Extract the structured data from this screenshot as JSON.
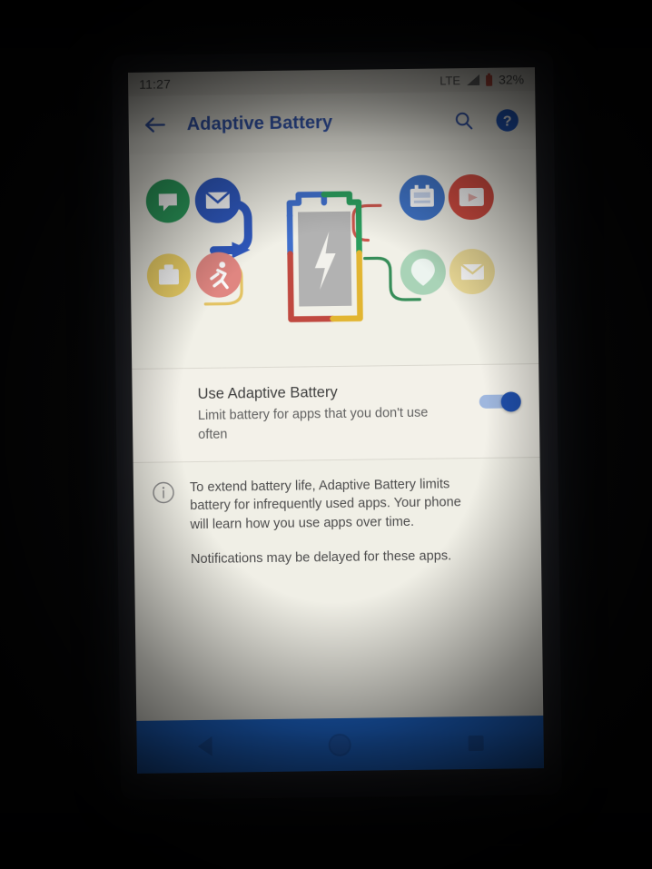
{
  "statusbar": {
    "clock": "11:27",
    "network": "LTE",
    "battery_percent": "32%",
    "signal_icon": "signal-bars-icon",
    "battery_icon": "battery-low-icon"
  },
  "appbar": {
    "title": "Adaptive Battery",
    "back_icon": "arrow-back-icon",
    "search_icon": "search-icon",
    "help_icon": "help-circle-icon",
    "title_color": "#2f55b3"
  },
  "illustration": {
    "name": "adaptive-battery-illustration",
    "battery_glyph": "lightning-bolt-icon",
    "battery_outline_colors": [
      "#3b6fd4",
      "#23a05a",
      "#c8463c",
      "#e8b726"
    ],
    "apps_left": [
      {
        "name": "chat-app-icon",
        "glyph": "speech-bubble",
        "color": "#24a05a"
      },
      {
        "name": "mail-app-icon",
        "glyph": "envelope",
        "color": "#2a58c8"
      },
      {
        "name": "work-app-icon",
        "glyph": "briefcase",
        "color": "#f2d45e"
      },
      {
        "name": "fitness-app-icon",
        "glyph": "running-person",
        "color": "#e8857f"
      }
    ],
    "apps_right": [
      {
        "name": "news-app-icon",
        "glyph": "newspaper",
        "color": "#3b74cf"
      },
      {
        "name": "video-app-icon",
        "glyph": "play-window",
        "color": "#de4a3e"
      },
      {
        "name": "maps-app-icon",
        "glyph": "map-pin",
        "color": "#a8d6b8"
      },
      {
        "name": "mail-muted-app-icon",
        "glyph": "envelope",
        "color": "#f0dd93"
      }
    ]
  },
  "toggle_row": {
    "title": "Use Adaptive Battery",
    "subtitle": "Limit battery for apps that you don't use often",
    "switch_on": true,
    "switch_color": "#1a4fb5"
  },
  "info_row": {
    "icon": "info-circle-icon",
    "paragraph_1": "To extend battery life, Adaptive Battery limits battery for infrequently used apps. Your phone will learn how you use apps over time.",
    "paragraph_2": "Notifications may be delayed for these apps."
  },
  "navbar": {
    "background": "#1667d8",
    "back_label": "back-button",
    "home_label": "home-button",
    "recents_label": "recents-button"
  }
}
